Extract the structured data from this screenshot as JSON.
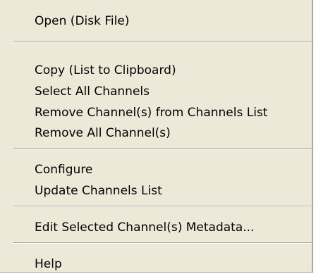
{
  "menu": {
    "items": [
      {
        "label": "Open (Disk File)"
      },
      {
        "label": "Copy (List to Clipboard)"
      },
      {
        "label": "Select All Channels"
      },
      {
        "label": "Remove Channel(s) from Channels List"
      },
      {
        "label": "Remove All Channel(s)"
      },
      {
        "label": "Configure"
      },
      {
        "label": "Update Channels List"
      },
      {
        "label": "Edit Selected Channel(s) Metadata..."
      },
      {
        "label": "Help"
      }
    ]
  },
  "colors": {
    "menu_background": "#ece9d8",
    "separator_shadow": "#aca899",
    "separator_highlight": "#ffffff",
    "text": "#000000"
  }
}
